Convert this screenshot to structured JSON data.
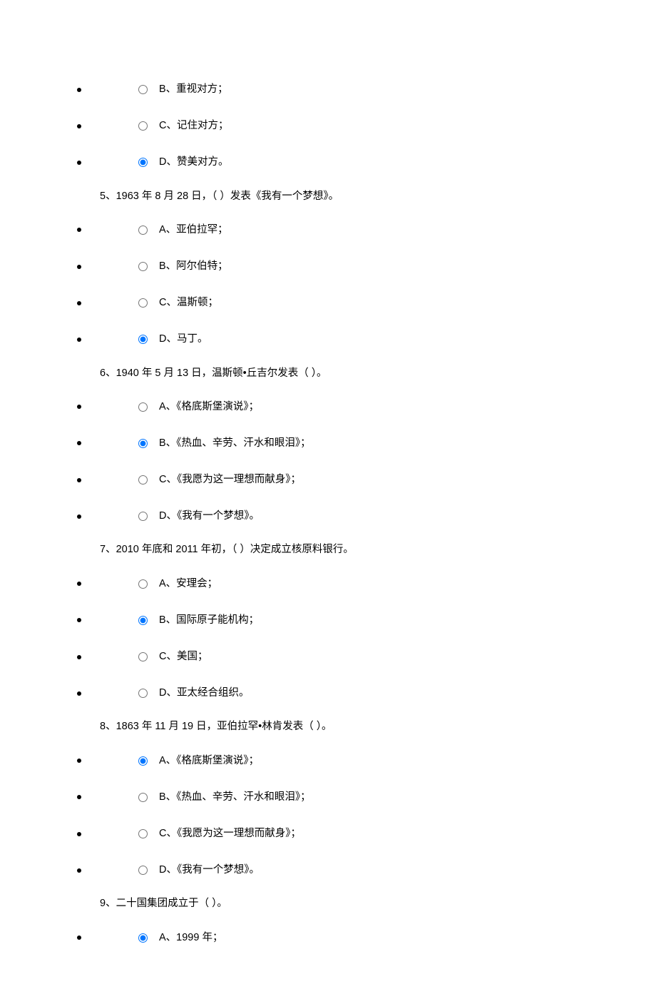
{
  "groups": [
    {
      "question": null,
      "options": [
        {
          "text": "B、重视对方；",
          "selected": false
        },
        {
          "text": "C、记住对方；",
          "selected": false
        },
        {
          "text": "D、赞美对方。",
          "selected": true
        }
      ]
    },
    {
      "question": "5、1963 年 8 月 28 日，（ ）发表《我有一个梦想》。",
      "options": [
        {
          "text": "A、亚伯拉罕；",
          "selected": false
        },
        {
          "text": "B、阿尔伯特；",
          "selected": false
        },
        {
          "text": "C、温斯顿；",
          "selected": false
        },
        {
          "text": "D、马丁。",
          "selected": true
        }
      ]
    },
    {
      "question": "6、1940 年 5 月 13 日，温斯顿•丘吉尔发表（ ）。",
      "options": [
        {
          "text": "A、《格底斯堡演说》；",
          "selected": false
        },
        {
          "text": "B、《热血、辛劳、汗水和眼泪》；",
          "selected": true
        },
        {
          "text": "C、《我愿为这一理想而献身》；",
          "selected": false
        },
        {
          "text": "D、《我有一个梦想》。",
          "selected": false
        }
      ]
    },
    {
      "question": "7、2010 年底和 2011 年初，（ ）决定成立核原料银行。",
      "options": [
        {
          "text": "A、安理会；",
          "selected": false
        },
        {
          "text": "B、国际原子能机构；",
          "selected": true
        },
        {
          "text": "C、美国；",
          "selected": false
        },
        {
          "text": "D、亚太经合组织。",
          "selected": false
        }
      ]
    },
    {
      "question": "8、1863 年 11 月 19 日，亚伯拉罕•林肯发表（ ）。",
      "options": [
        {
          "text": "A、《格底斯堡演说》；",
          "selected": true
        },
        {
          "text": "B、《热血、辛劳、汗水和眼泪》；",
          "selected": false
        },
        {
          "text": "C、《我愿为这一理想而献身》；",
          "selected": false
        },
        {
          "text": "D、《我有一个梦想》。",
          "selected": false
        }
      ]
    },
    {
      "question": "9、二十国集团成立于（ ）。",
      "options": [
        {
          "text": "A、1999 年；",
          "selected": true
        }
      ]
    }
  ]
}
